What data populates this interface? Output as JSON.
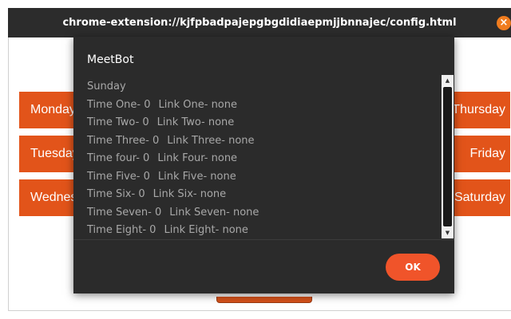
{
  "titlebar": {
    "title": "chrome-extension://kjfpbadpajepgbgdidiaepmjjbnnajec/config.html",
    "close_glyph": "×"
  },
  "days": {
    "left": [
      "Monday",
      "Tuesday",
      "Wednesday"
    ],
    "right": [
      "Thursday",
      "Friday",
      "Saturday"
    ]
  },
  "dialog": {
    "title": "MeetBot",
    "heading": "Sunday",
    "rows": [
      {
        "time": "Time One- 0",
        "link": "Link One- none"
      },
      {
        "time": "Time Two- 0",
        "link": "Link Two- none"
      },
      {
        "time": "Time Three- 0",
        "link": "Link Three- none"
      },
      {
        "time": "Time four- 0",
        "link": "Link Four- none"
      },
      {
        "time": "Time Five- 0",
        "link": "Link Five- none"
      },
      {
        "time": "Time Six- 0",
        "link": "Link Six- none"
      },
      {
        "time": "Time Seven- 0",
        "link": "Link Seven- none"
      },
      {
        "time": "Time Eight- 0",
        "link": "Link Eight- none"
      }
    ],
    "ok_label": "OK"
  },
  "colors": {
    "accent": "#e2541a",
    "dialog_bg": "#2b2b2b",
    "ok_button": "#f0542a"
  }
}
